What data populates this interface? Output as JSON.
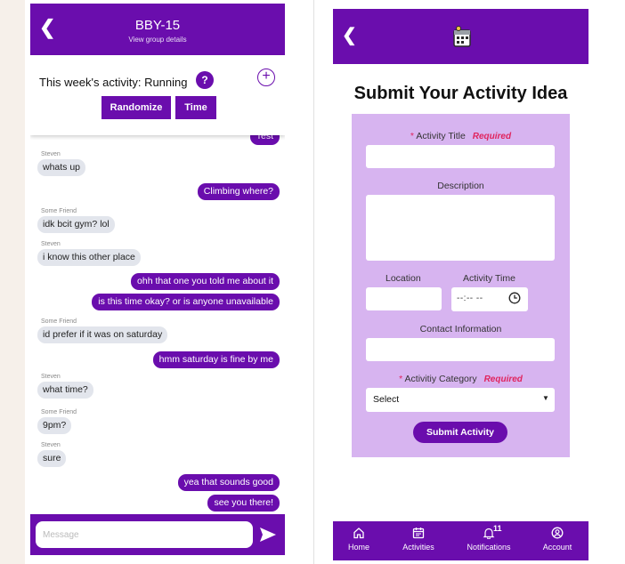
{
  "chat": {
    "group_name": "BBY-15",
    "view_details": "View group details",
    "activity_text": "This week's activity: Running",
    "help_badge": "?",
    "add_glyph": "+",
    "randomize_label": "Randomize",
    "time_label": "Time",
    "input_placeholder": "Message",
    "messages": [
      {
        "sender": "",
        "text": "Test",
        "outgoing": true
      },
      {
        "sender": "Steven",
        "text": "whats up",
        "outgoing": false
      },
      {
        "sender": "",
        "text": "Climbing where?",
        "outgoing": true
      },
      {
        "sender": "Some Friend",
        "text": "idk bcit gym? lol",
        "outgoing": false
      },
      {
        "sender": "Steven",
        "text": "i know this other place",
        "outgoing": false
      },
      {
        "sender": "",
        "text": "ohh that one you told me about it",
        "outgoing": true
      },
      {
        "sender": "",
        "text": "is this time okay? or is anyone unavailable",
        "outgoing": true
      },
      {
        "sender": "Some Friend",
        "text": "id prefer if it was on saturday",
        "outgoing": false
      },
      {
        "sender": "",
        "text": "hmm saturday is fine by me",
        "outgoing": true
      },
      {
        "sender": "Steven",
        "text": "what time?",
        "outgoing": false
      },
      {
        "sender": "Some Friend",
        "text": "9pm?",
        "outgoing": false
      },
      {
        "sender": "Steven",
        "text": "sure",
        "outgoing": false
      },
      {
        "sender": "",
        "text": "yea that sounds good",
        "outgoing": true
      },
      {
        "sender": "",
        "text": "see you there!",
        "outgoing": true
      }
    ]
  },
  "submit": {
    "title": "Submit Your Activity Idea",
    "star": "*",
    "required_text": "Required",
    "activity_title_label": "Activity Title",
    "description_label": "Description",
    "location_label": "Location",
    "activity_time_label": "Activity Time",
    "time_value": "--:-- --",
    "contact_label": "Contact Information",
    "category_label": "Activitiy Category",
    "category_value": "Select",
    "submit_label": "Submit Activity"
  },
  "nav": {
    "items": [
      {
        "label": "Home",
        "icon": "home-icon"
      },
      {
        "label": "Activities",
        "icon": "calendar-icon"
      },
      {
        "label": "Notifications",
        "icon": "bell-icon"
      },
      {
        "label": "Account",
        "icon": "account-icon"
      }
    ],
    "notification_count": "11"
  },
  "colors": {
    "brand_purple": "#6a0dad",
    "form_lavender": "#d7b4f0",
    "incoming_bubble": "#e2e5ec",
    "required_red": "#e0245e"
  }
}
